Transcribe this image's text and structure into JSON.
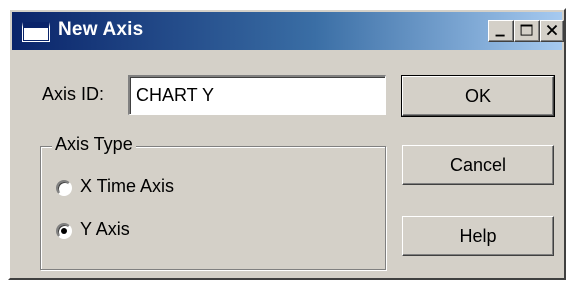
{
  "window": {
    "title": "New Axis"
  },
  "titlebar_buttons": {
    "minimize": "minimize-icon",
    "maximize": "maximize-icon",
    "close": "close-icon"
  },
  "axis_id": {
    "label": "Axis ID:",
    "value": "CHART Y"
  },
  "axis_type": {
    "group_label": "Axis Type",
    "options": [
      {
        "label": "X Time Axis",
        "selected": false
      },
      {
        "label": "Y Axis",
        "selected": true
      }
    ]
  },
  "buttons": {
    "ok": "OK",
    "cancel": "Cancel",
    "help": "Help"
  }
}
